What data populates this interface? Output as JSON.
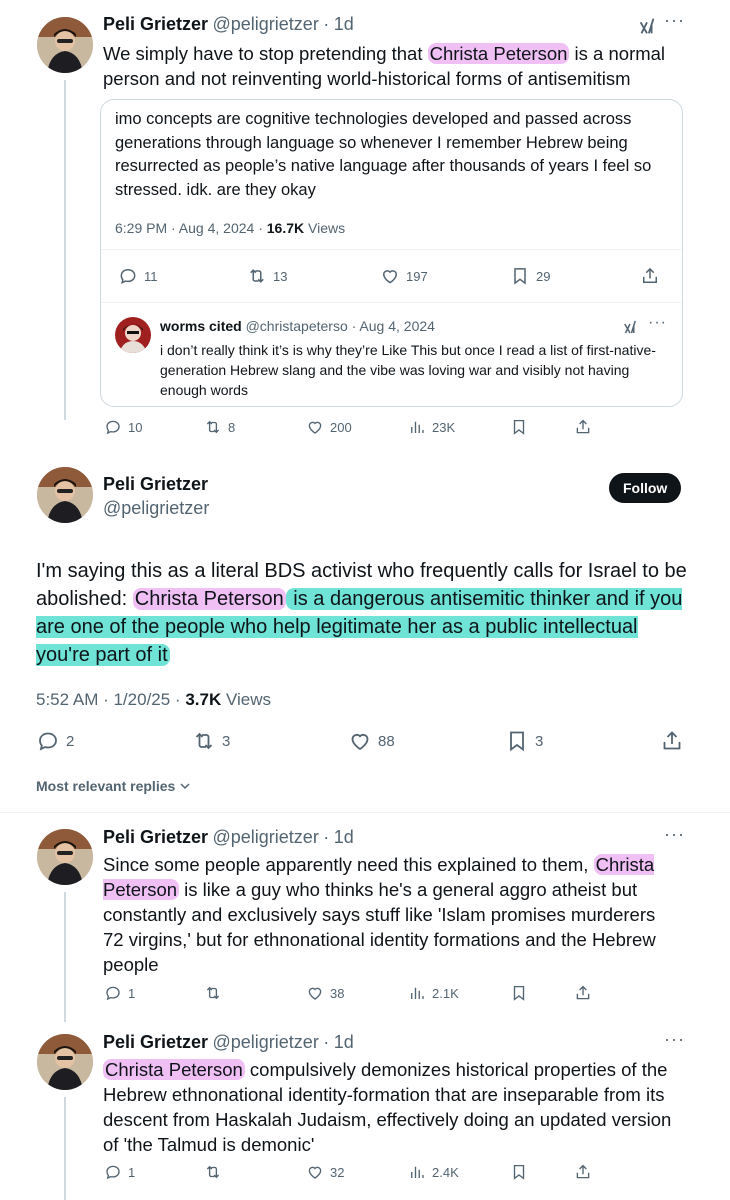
{
  "tweet1": {
    "name": "Peli Grietzer",
    "handle": "@peligrietzer",
    "sep": "·",
    "time": "1d",
    "text_before": "We simply have to stop pretending that ",
    "text_highlight": "Christa Peterson",
    "text_after": " is a normal person and not reinventing world-historical forms of antisemitism",
    "quoted": {
      "text": "imo concepts are cognitive technologies developed and passed across generations through language so whenever I remember Hebrew being resurrected as people’s native language after thousands of years I feel so stressed. idk. are they okay",
      "timestamp": "6:29 PM · Aug 4, 2024 · ",
      "views_count": "16.7K",
      "views_label": " Views",
      "replies": "11",
      "retweets": "13",
      "likes": "197",
      "bookmarks": "29",
      "reply": {
        "name": "worms cited",
        "handle": "@christapeterso",
        "date": "· Aug 4, 2024",
        "text": "i don’t really think it’s is why they’re Like This but once I read a list of first-native-generation Hebrew slang and the vibe was loving war and visibly not having enough words"
      }
    },
    "replies": "10",
    "retweets": "8",
    "likes": "200",
    "views": "23K"
  },
  "main": {
    "name": "Peli Grietzer",
    "handle": "@peligrietzer",
    "follow_label": "Follow",
    "text_a": "I'm saying this as a literal BDS activist who frequently calls for Israel to be abolished: ",
    "text_pink": "Christa Peterson",
    "text_teal": " is a dangerous antisemitic thinker and if you are one of the people who help legitimate her as a public intellectual you're part of it",
    "timestamp": "5:52 AM · 1/20/25 · ",
    "views_count": "3.7K",
    "views_label": " Views",
    "replies": "2",
    "retweets": "3",
    "likes": "88",
    "bookmarks": "3"
  },
  "sort_label": "Most relevant replies",
  "reply1": {
    "name": "Peli Grietzer",
    "handle": "@peligrietzer",
    "sep": "·",
    "time": "1d",
    "text_before": "Since some people apparently need this explained to them, ",
    "text_highlight": "Christa Peterson",
    "text_after": " is like a guy who thinks he's a general aggro atheist but constantly and exclusively says stuff like 'Islam promises murderers 72 virgins,' but for ethnonational identity formations and the Hebrew people",
    "replies": "1",
    "likes": "38",
    "views": "2.1K"
  },
  "reply2": {
    "name": "Peli Grietzer",
    "handle": "@peligrietzer",
    "sep": "·",
    "time": "1d",
    "text_highlight": "Christa Peterson",
    "text_after": " compulsively demonizes historical properties of the Hebrew ethnonational identity-formation that are inseparable from its descent from Haskalah Judaism, effectively doing an updated version of 'the Talmud is demonic'",
    "replies": "1",
    "likes": "32",
    "views": "2.4K"
  },
  "colors": {
    "highlight_pink": "#f0c0f5",
    "highlight_teal": "#6fe3d6",
    "muted": "#536471",
    "border": "#cfd9de"
  },
  "icons": [
    "reply-icon",
    "retweet-icon",
    "like-icon",
    "views-icon",
    "bookmark-icon",
    "share-icon",
    "grok-icon",
    "more-icon",
    "chevron-down-icon"
  ]
}
